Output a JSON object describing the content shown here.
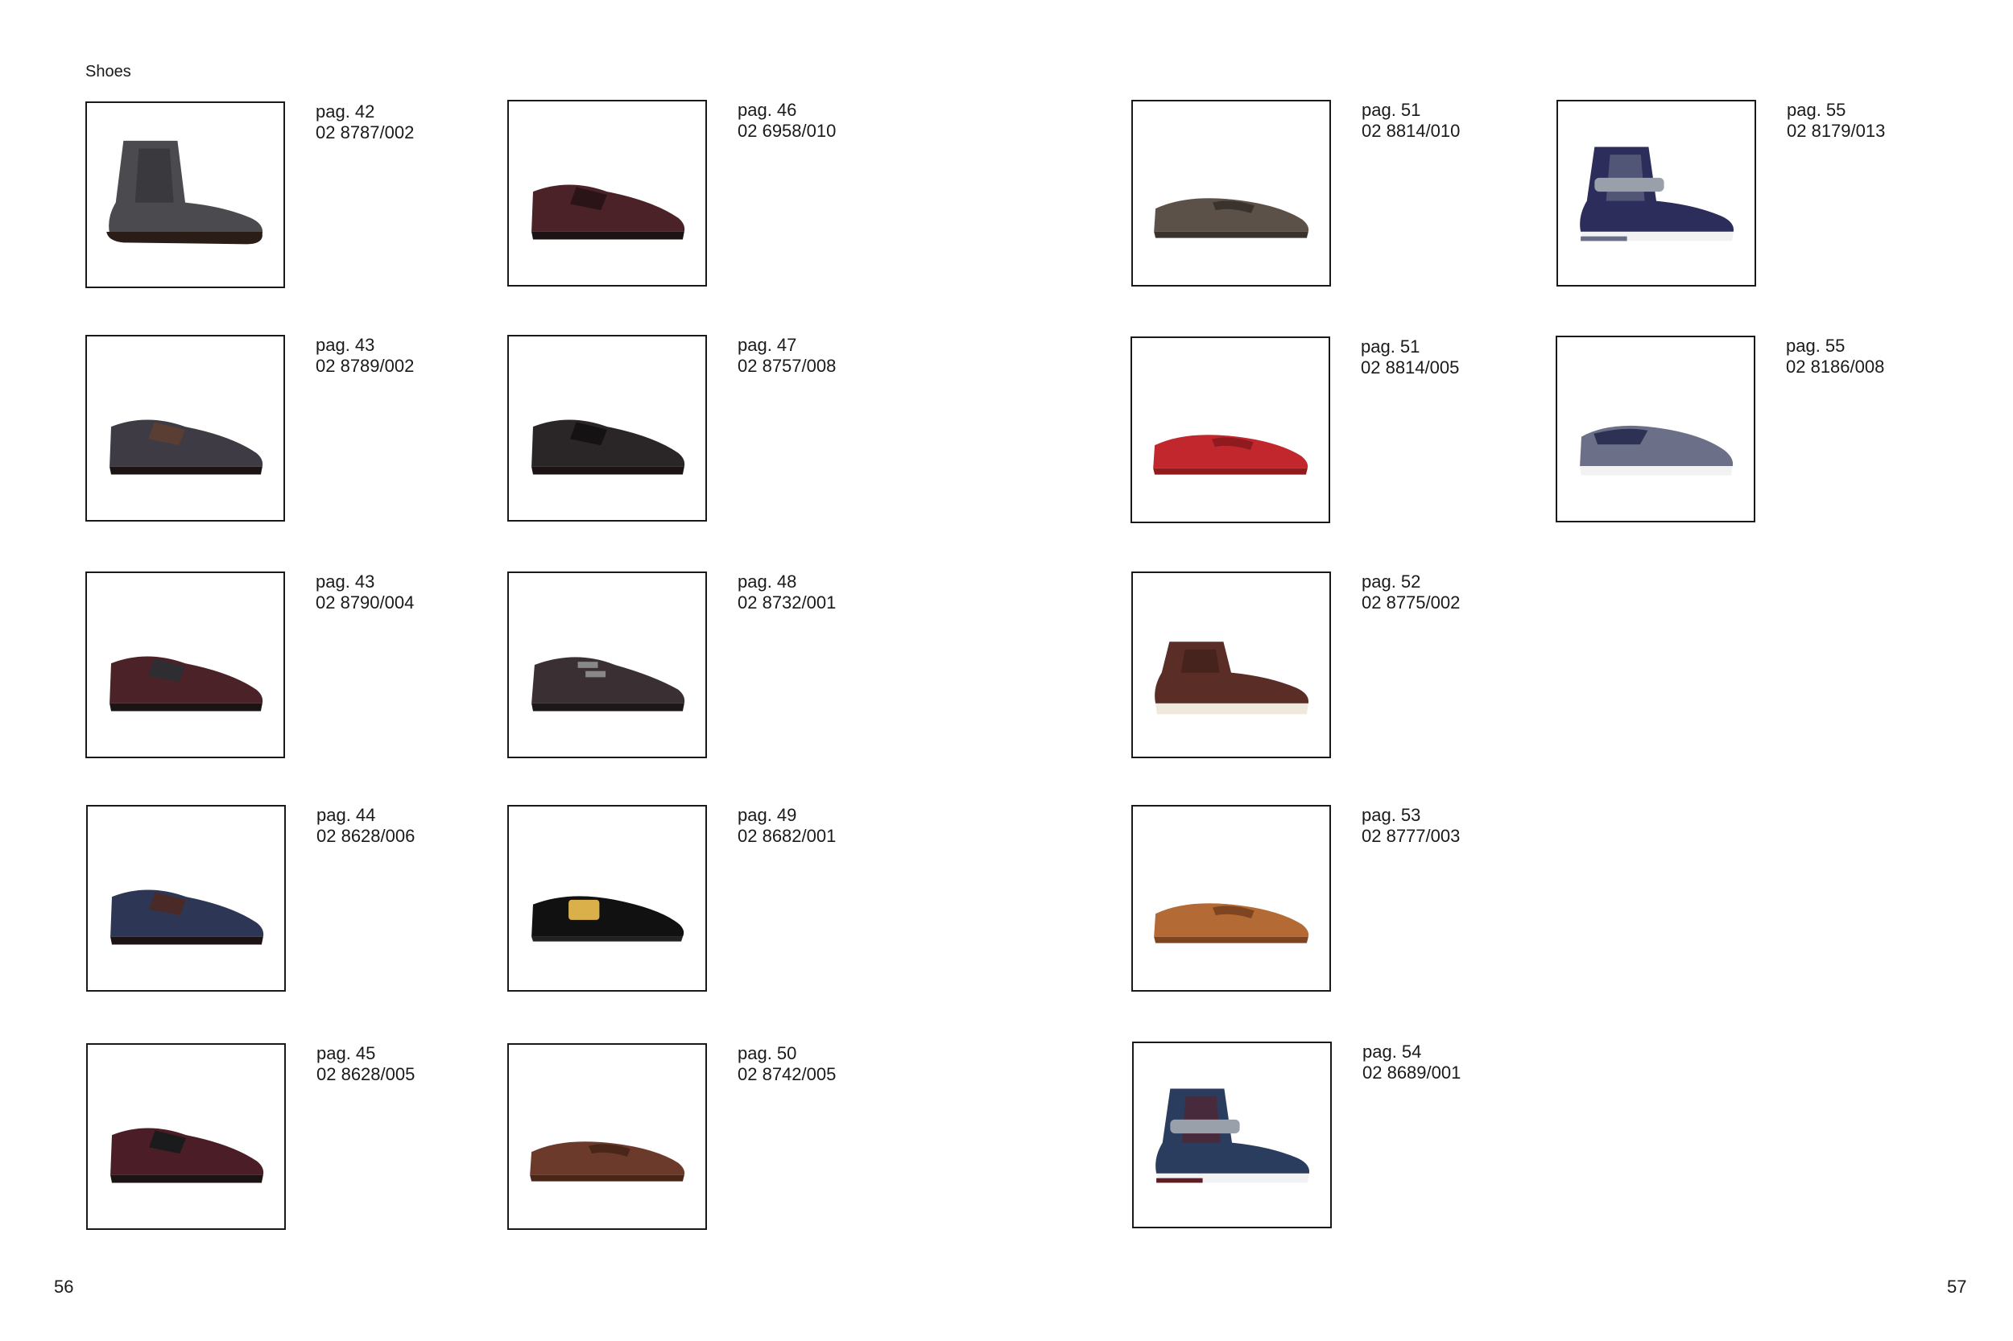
{
  "section_title": "Shoes",
  "page_left": "56",
  "page_right": "57",
  "products": [
    {
      "page": "pag. 42",
      "code": "02 8787/002",
      "style": "boot",
      "color": "#4a4a4f",
      "accent": "#2f2f33"
    },
    {
      "page": "pag. 46",
      "code": "02 6958/010",
      "style": "oxford",
      "color": "#4b2228",
      "accent": "#2b1418"
    },
    {
      "page": "pag. 51",
      "code": "02 8814/010",
      "style": "loafer",
      "color": "#5b5148",
      "accent": "#3a332d"
    },
    {
      "page": "pag. 55",
      "code": "02 8179/013",
      "style": "hightop",
      "color": "#2c2d5a",
      "accent": "#6a6f88"
    },
    {
      "page": "pag. 43",
      "code": "02 8789/002",
      "style": "derby",
      "color": "#3e3b44",
      "accent": "#5a3e34"
    },
    {
      "page": "pag. 47",
      "code": "02 8757/008",
      "style": "oxford",
      "color": "#2a2526",
      "accent": "#151213"
    },
    {
      "page": "pag. 51",
      "code": "02 8814/005",
      "style": "loafer",
      "color": "#c1272d",
      "accent": "#8f1b1f"
    },
    {
      "page": "pag. 55",
      "code": "02 8186/008",
      "style": "slipon",
      "color": "#6b7088",
      "accent": "#2d3154"
    },
    {
      "page": "pag. 43",
      "code": "02 8790/004",
      "style": "derby",
      "color": "#4c2229",
      "accent": "#2d2d32"
    },
    {
      "page": "pag. 48",
      "code": "02 8732/001",
      "style": "monk",
      "color": "#3a3034",
      "accent": "#1c1719"
    },
    {
      "page": "pag. 52",
      "code": "02 8775/002",
      "style": "chukka",
      "color": "#5a2d27",
      "accent": "#3b1c18"
    },
    {
      "page": "pag. 44",
      "code": "02 8628/006",
      "style": "oxford",
      "color": "#2d3654",
      "accent": "#4a2a26"
    },
    {
      "page": "pag. 49",
      "code": "02 8682/001",
      "style": "slipper",
      "color": "#111111",
      "accent": "#d9b04a"
    },
    {
      "page": "pag. 53",
      "code": "02 8777/003",
      "style": "loafer",
      "color": "#b36a35",
      "accent": "#7e4520"
    },
    {
      "page": "pag. 45",
      "code": "02 8628/005",
      "style": "oxford",
      "color": "#4a1d27",
      "accent": "#1b1b1d"
    },
    {
      "page": "pag. 50",
      "code": "02 8742/005",
      "style": "loafer",
      "color": "#6b3a2b",
      "accent": "#4a2619"
    },
    {
      "page": "pag. 54",
      "code": "02 8689/001",
      "style": "hightop",
      "color": "#2a3d5e",
      "accent": "#5b1f28"
    }
  ]
}
